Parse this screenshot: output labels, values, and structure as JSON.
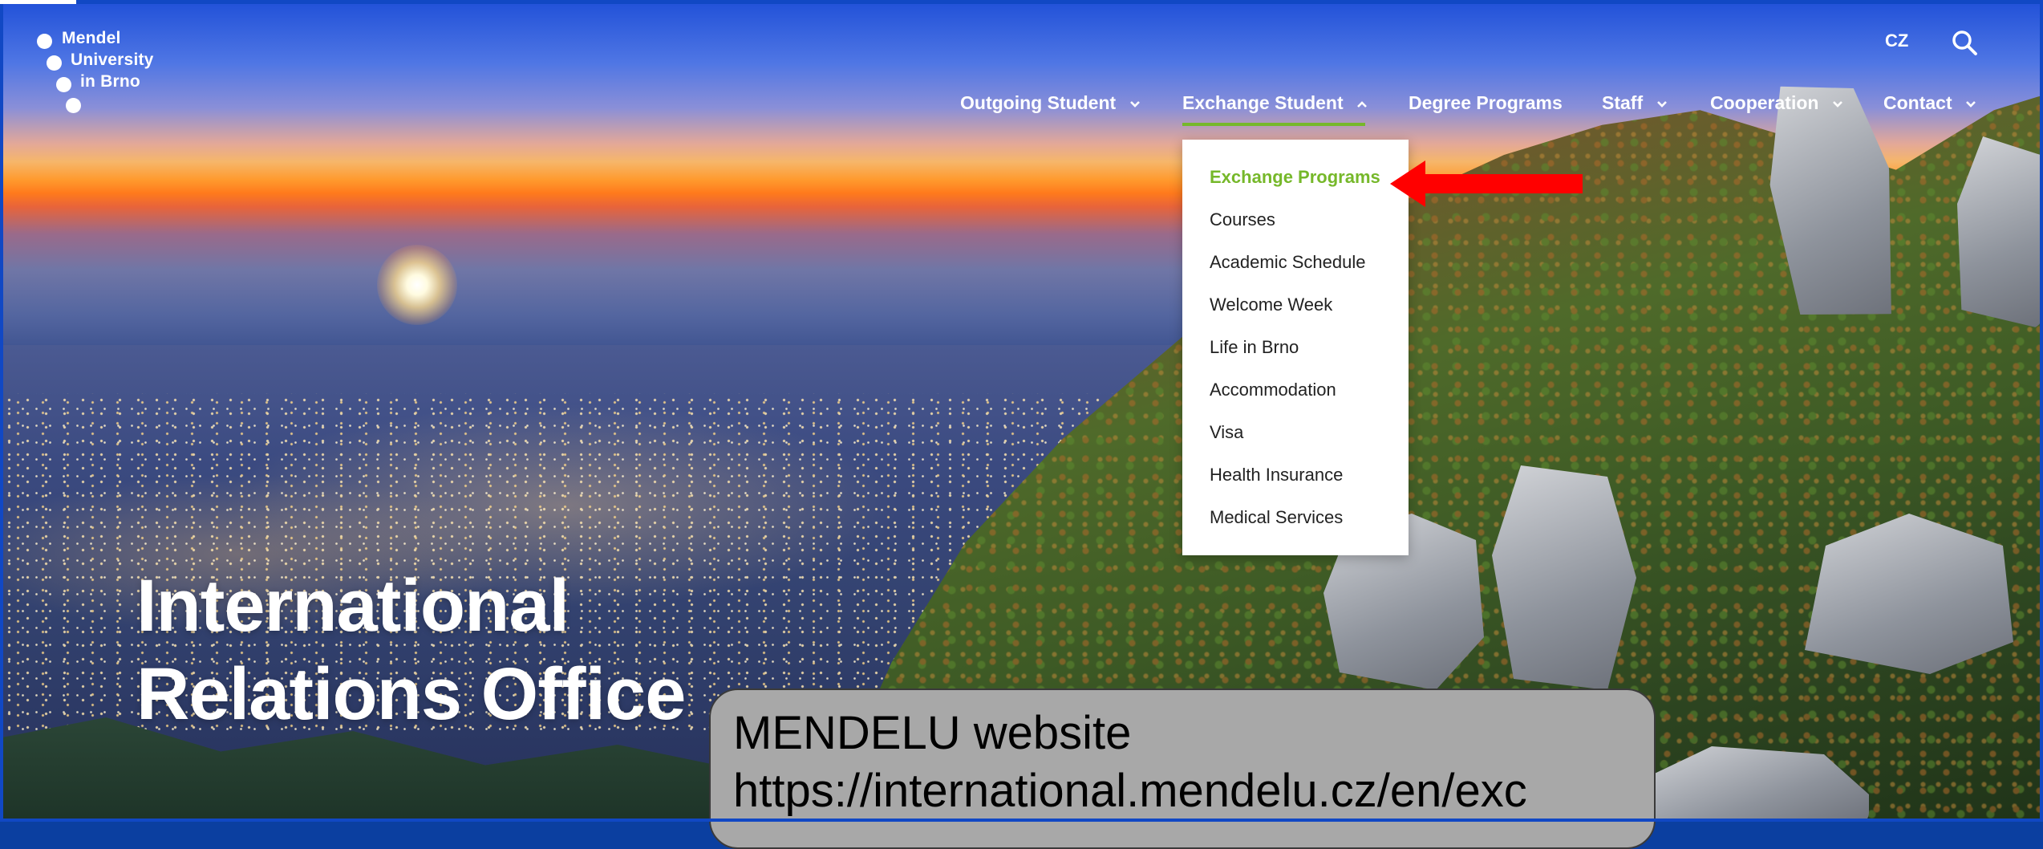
{
  "logo": {
    "line1": "Mendel",
    "line2": "University",
    "line3": "in Brno"
  },
  "header": {
    "lang_label": "CZ",
    "search_icon": "search-icon",
    "nav": [
      {
        "label": "Outgoing Student",
        "has_dropdown": true,
        "expanded": false
      },
      {
        "label": "Exchange Student",
        "has_dropdown": true,
        "expanded": true
      },
      {
        "label": "Degree Programs",
        "has_dropdown": false
      },
      {
        "label": "Staff",
        "has_dropdown": true,
        "expanded": false
      },
      {
        "label": "Cooperation",
        "has_dropdown": true,
        "expanded": false
      },
      {
        "label": "Contact",
        "has_dropdown": true,
        "expanded": false
      }
    ]
  },
  "dropdown": {
    "items": [
      {
        "label": "Exchange Programs",
        "active": true
      },
      {
        "label": "Courses"
      },
      {
        "label": "Academic Schedule"
      },
      {
        "label": "Welcome Week"
      },
      {
        "label": "Life in Brno"
      },
      {
        "label": "Accommodation"
      },
      {
        "label": "Visa"
      },
      {
        "label": "Health Insurance"
      },
      {
        "label": "Medical Services"
      }
    ]
  },
  "hero": {
    "title_line1": "International",
    "title_line2": "Relations Office"
  },
  "caption": {
    "line1": "MENDELU website",
    "line2": "https://international.mendelu.cz/en/exc"
  },
  "colors": {
    "accent_green": "#76b82a",
    "annotation_red": "#ff0000",
    "caption_bg": "#a8a8a8"
  }
}
